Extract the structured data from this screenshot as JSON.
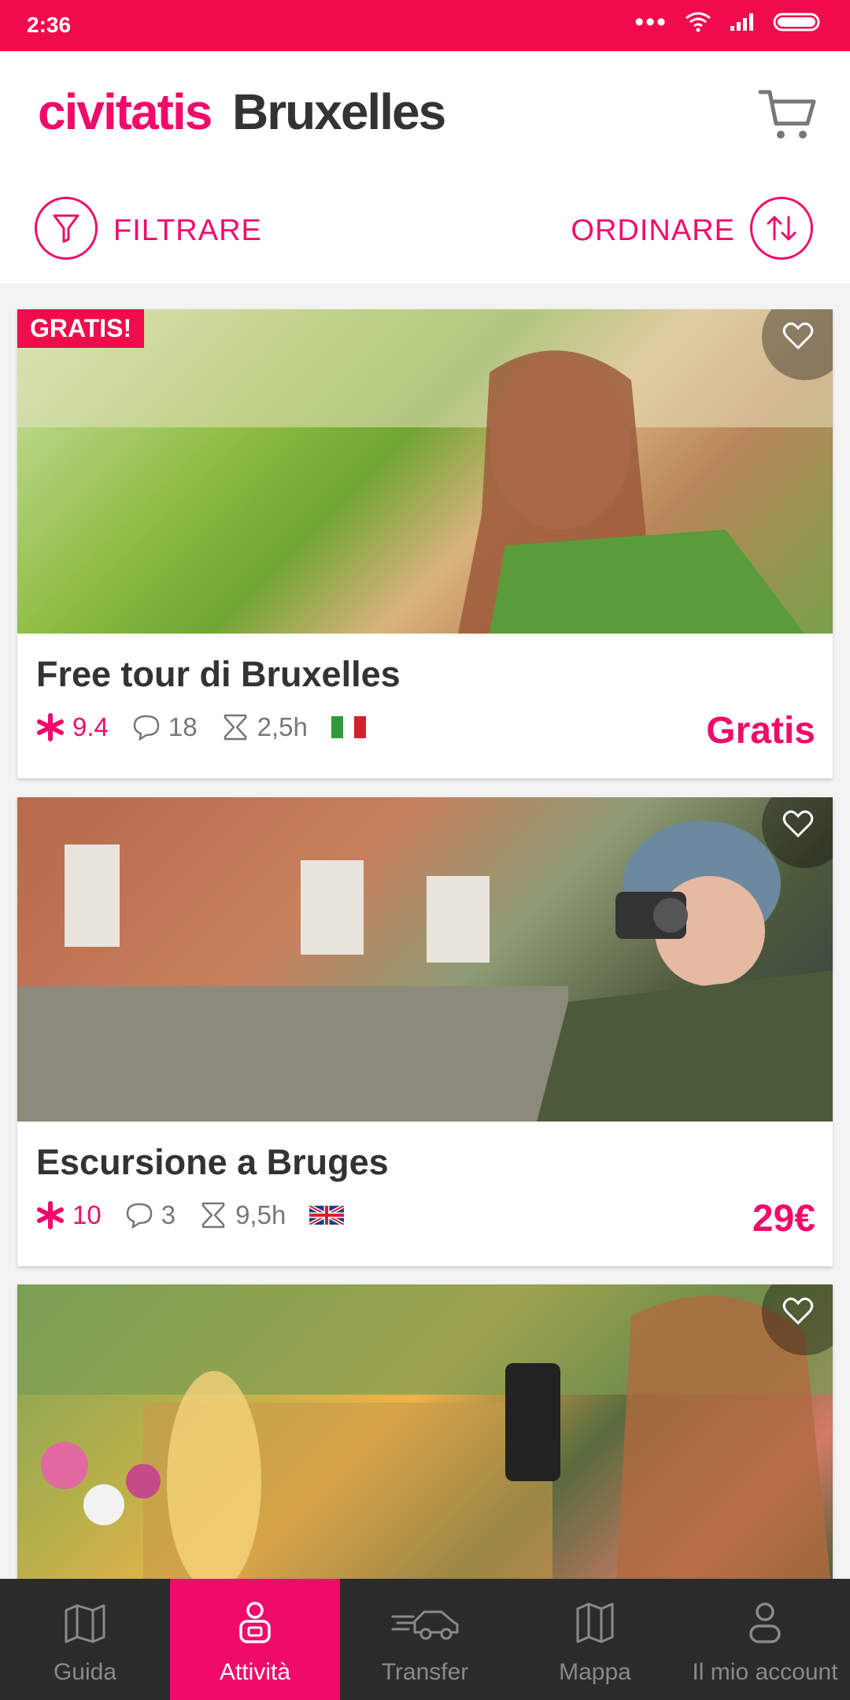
{
  "status": {
    "time": "2:36"
  },
  "header": {
    "logo": "civitatis",
    "city": "Bruxelles"
  },
  "actions": {
    "filter": "FILTRARE",
    "order": "ORDINARE"
  },
  "cards": [
    {
      "badge": "GRATIS!",
      "title": "Free tour di Bruxelles",
      "rating": "9.4",
      "comments": "18",
      "duration": "2,5h",
      "flag": "it-flag-icon",
      "price": "Gratis"
    },
    {
      "title": "Escursione a Bruges",
      "rating": "10",
      "comments": "3",
      "duration": "9,5h",
      "flag": "uk-flag-icon",
      "price": "29€"
    },
    {
      "title": "",
      "price": ""
    }
  ],
  "nav": [
    {
      "label": "Guida",
      "icon": "map-icon"
    },
    {
      "label": "Attività",
      "icon": "activity-icon"
    },
    {
      "label": "Transfer",
      "icon": "car-icon"
    },
    {
      "label": "Mappa",
      "icon": "map-fold-icon"
    },
    {
      "label": "Il mio account",
      "icon": "user-icon"
    }
  ],
  "colors": {
    "brand": "#f00b6a",
    "status_bar": "#f00b4d",
    "nav_bg": "#2b2b2b"
  }
}
